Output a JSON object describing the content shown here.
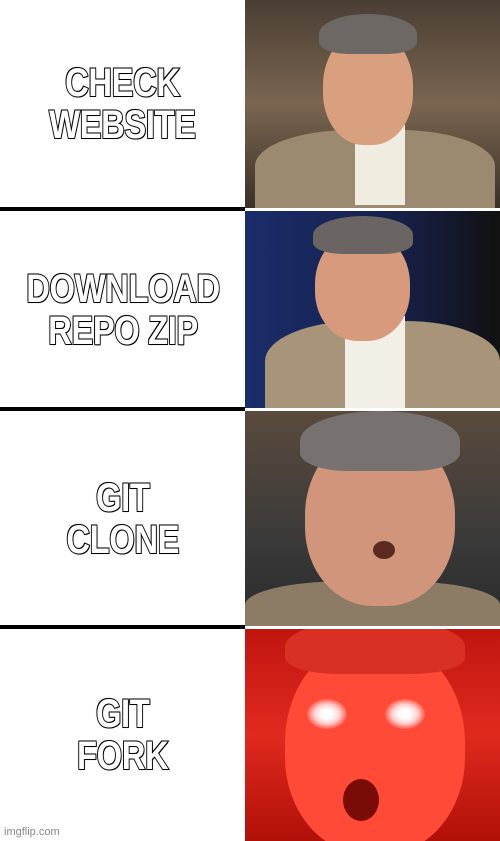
{
  "meme": {
    "panels": [
      {
        "caption": "CHECK\nWEBSITE",
        "tint": "#6b5a48"
      },
      {
        "caption": "DOWNLOAD\nREPO ZIP",
        "tint": "#1c2a55"
      },
      {
        "caption": "GIT\nCLONE",
        "tint": "#5a4a3c"
      },
      {
        "caption": "GIT\nFORK",
        "tint": "#e0201a"
      }
    ],
    "watermark": "imgflip.com"
  }
}
